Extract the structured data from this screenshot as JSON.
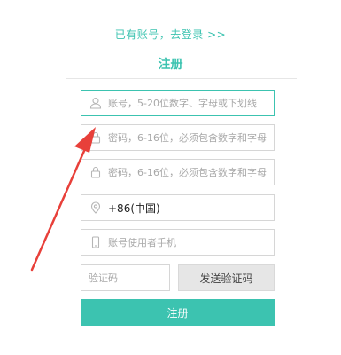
{
  "header": {
    "login_link": "已有账号，去登录 >>",
    "title": "注册"
  },
  "form": {
    "account": {
      "placeholder": "账号，5-20位数字、字母或下划线",
      "icon": "user-icon"
    },
    "password": {
      "placeholder": "密码，6-16位，必须包含数字和字母",
      "icon": "lock-icon"
    },
    "confirm_password": {
      "placeholder": "密码，6-16位，必须包含数字和字母",
      "icon": "lock-icon"
    },
    "region": {
      "value": "+86(中国)",
      "icon": "location-icon"
    },
    "phone": {
      "placeholder": "账号使用者手机",
      "icon": "phone-icon"
    },
    "verification_code": {
      "placeholder": "验证码"
    },
    "send_code_label": "发送验证码",
    "submit_label": "注册"
  },
  "colors": {
    "accent": "#3cc3b0",
    "annotation_arrow": "#e8403a",
    "button_gray": "#e6e6e6"
  }
}
